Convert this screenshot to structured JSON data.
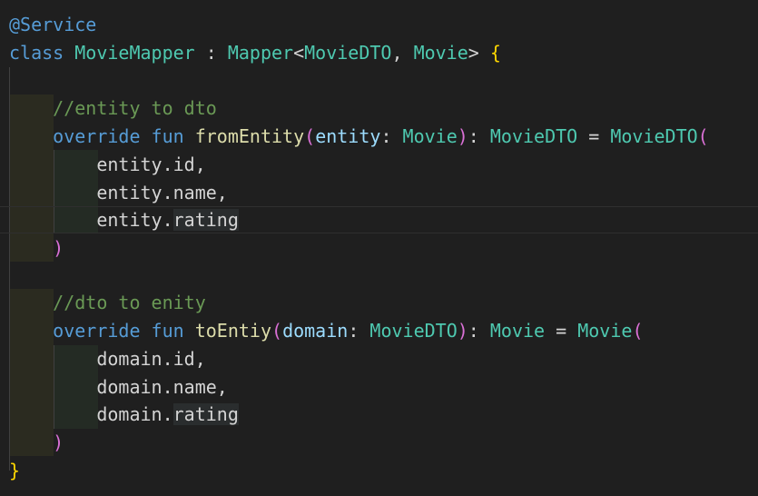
{
  "code": {
    "annotation": "@Service",
    "class_keyword": "class",
    "class_name": "MovieMapper",
    "colon": " : ",
    "interface": "Mapper",
    "generic_open": "<",
    "generic_a": "MovieDTO",
    "generic_sep": ", ",
    "generic_b": "Movie",
    "generic_close": ">",
    "open_brace": "{",
    "close_brace": "}",
    "f1": {
      "comment": "//entity to dto",
      "override": "override",
      "fun": "fun",
      "name": "fromEntity",
      "open_paren": "(",
      "param": "entity",
      "param_colon": ": ",
      "param_type": "Movie",
      "close_paren": ")",
      "ret_colon": ": ",
      "ret_type": "MovieDTO",
      "eq": " = ",
      "ctor": "MovieDTO",
      "ctor_open": "(",
      "arg1": "entity.id,",
      "arg2": "entity.name,",
      "arg3_prefix": "entity.",
      "arg3_field": "rating",
      "ctor_close": ")"
    },
    "f2": {
      "comment": "//dto to enity",
      "override": "override",
      "fun": "fun",
      "name": "toEntiy",
      "open_paren": "(",
      "param": "domain",
      "param_colon": ": ",
      "param_type": "MovieDTO",
      "close_paren": ")",
      "ret_colon": ": ",
      "ret_type": "Movie",
      "eq": " = ",
      "ctor": "Movie",
      "ctor_open": "(",
      "arg1": "domain.id,",
      "arg2": "domain.name,",
      "arg3_prefix": "domain.",
      "arg3_field": "rating",
      "ctor_close": ")"
    }
  }
}
